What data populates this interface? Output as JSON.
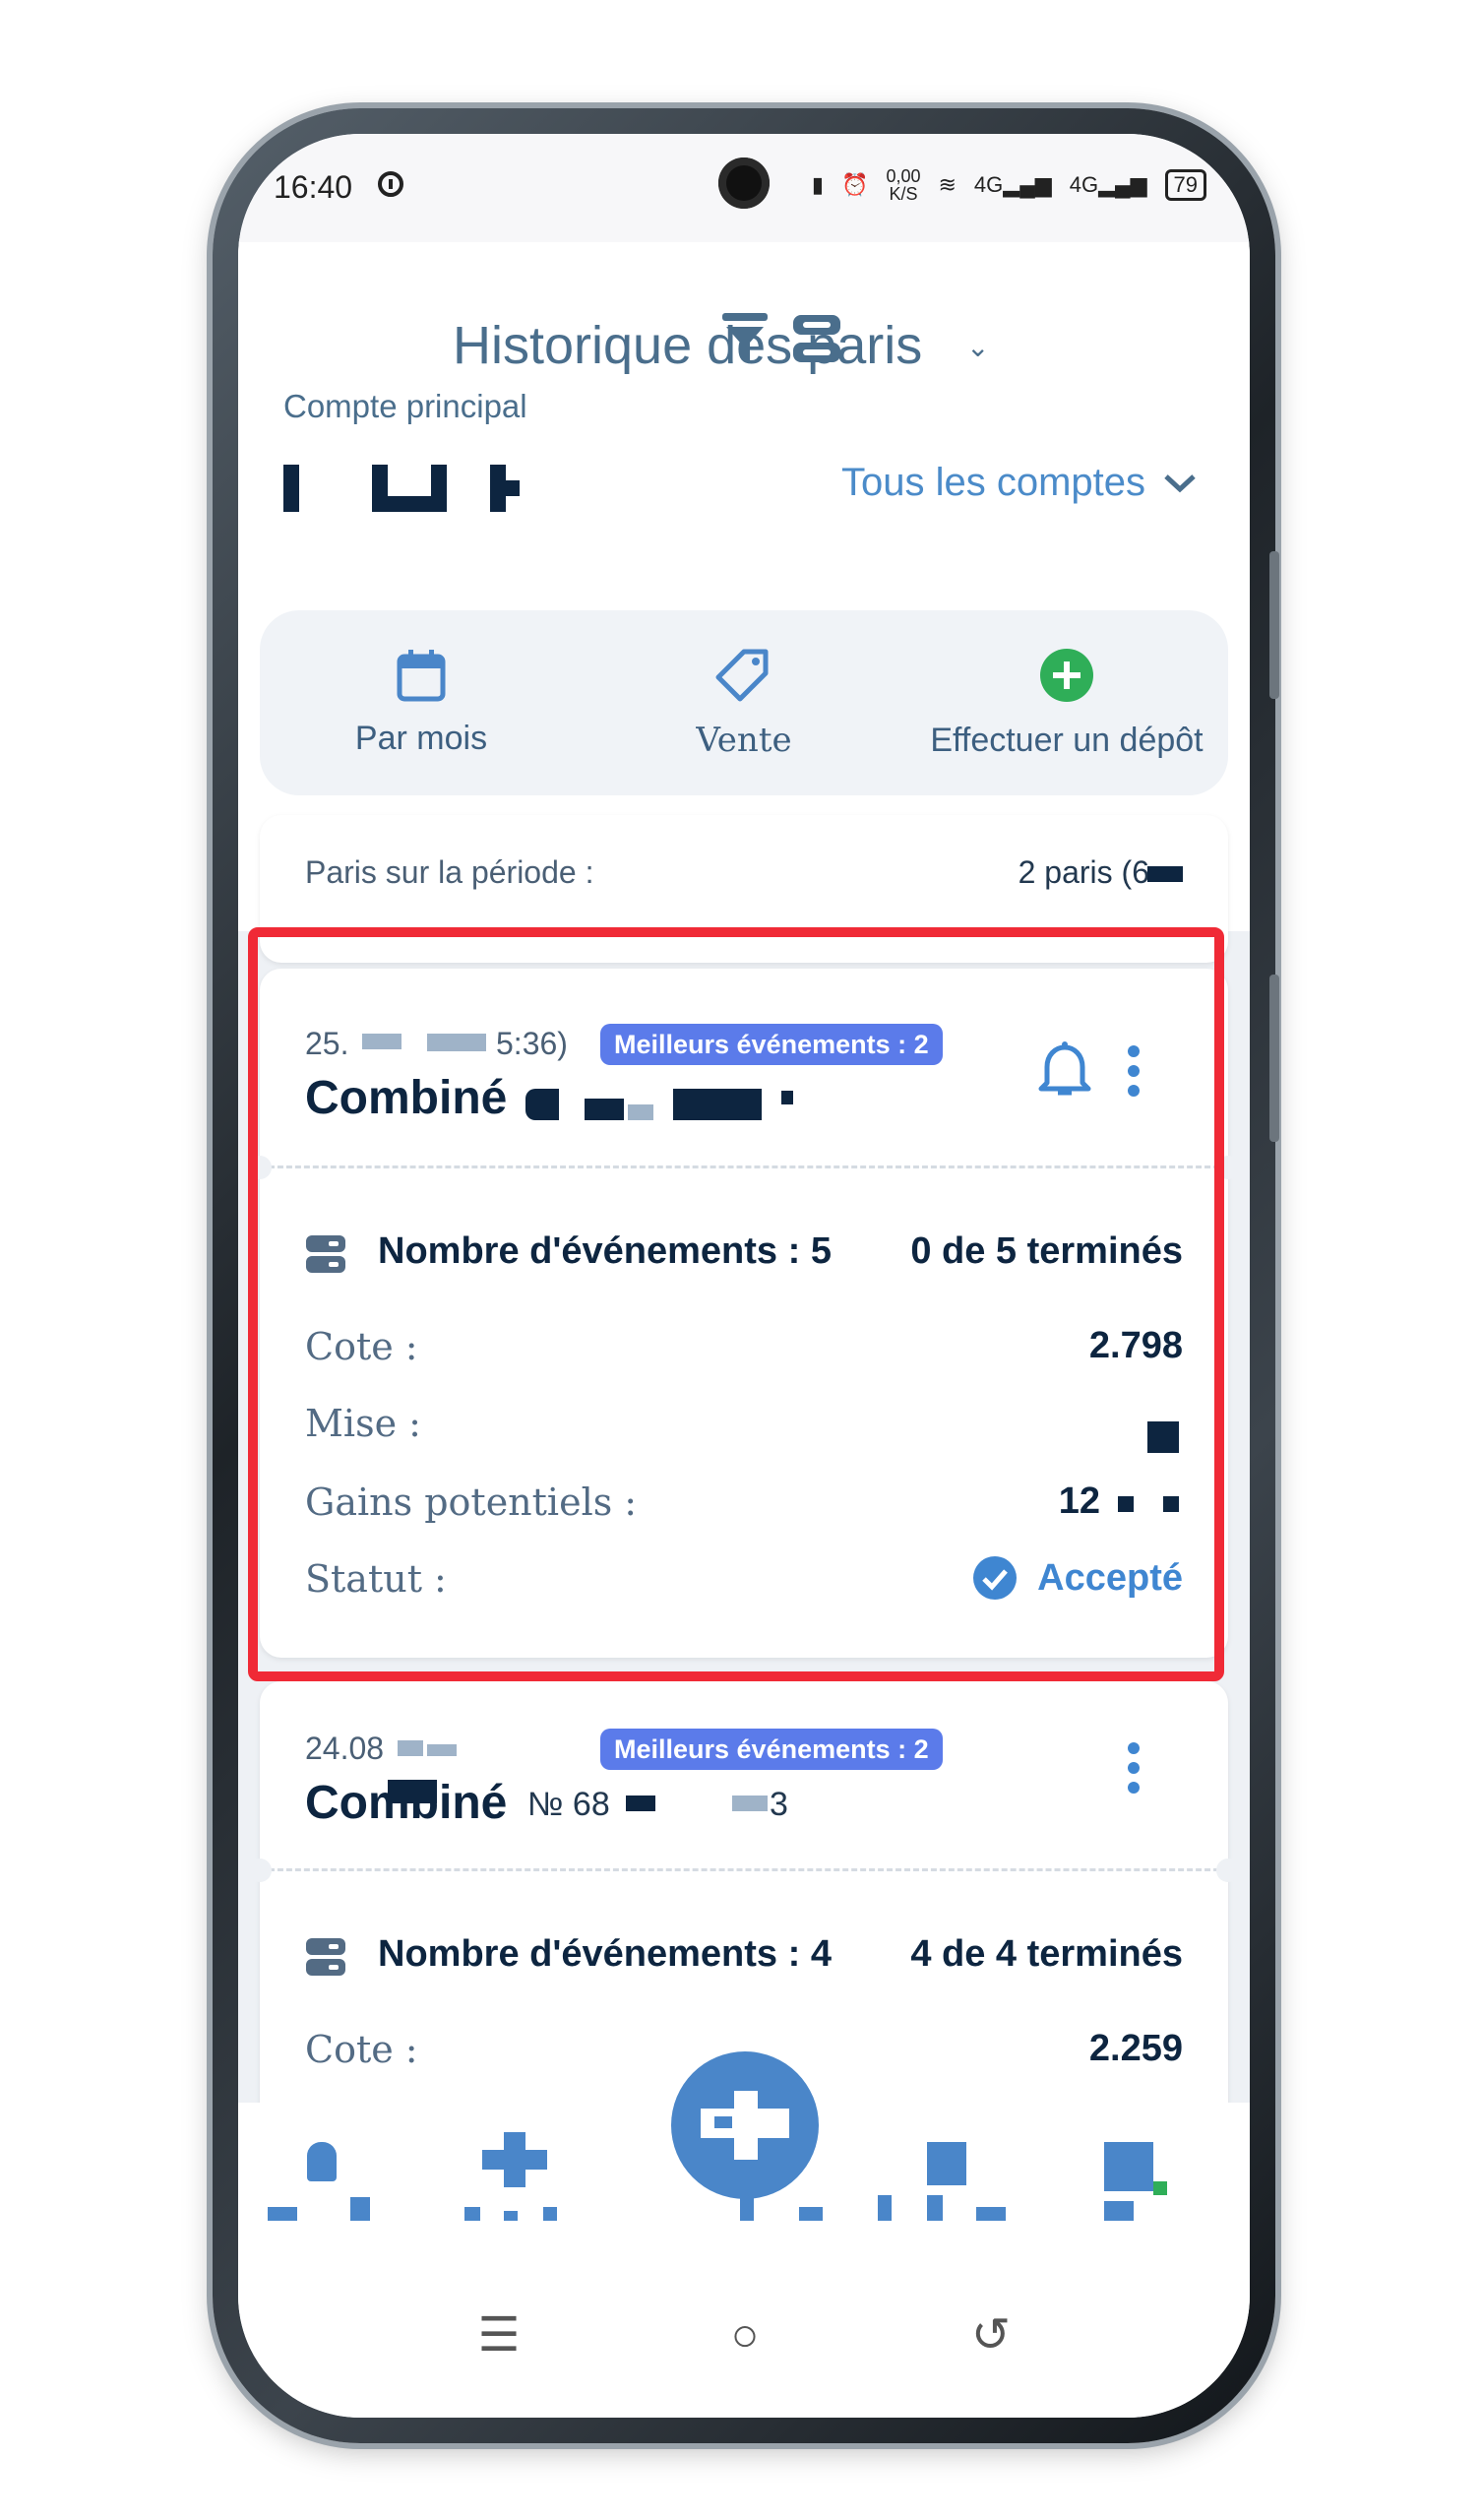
{
  "status_bar": {
    "time": "16:40",
    "network_speed": "0,00",
    "network_unit": "K/S",
    "signal1": "4G",
    "signal2": "4G",
    "battery": "79"
  },
  "header": {
    "title": "Historique des paris",
    "account_label": "Compte principal",
    "all_accounts": "Tous les comptes"
  },
  "actions": [
    {
      "label": "Par mois",
      "icon": "calendar-icon"
    },
    {
      "label": "Vente",
      "icon": "tag-icon"
    },
    {
      "label": "Effectuer un dépôt",
      "icon": "plus-circle-icon"
    }
  ],
  "period": {
    "label": "Paris sur la période :",
    "value": "2 paris (6"
  },
  "bets": [
    {
      "date": "25.",
      "time_fragment": "5:36)",
      "badge": "Meilleurs événements : 2",
      "title": "Combiné",
      "events_label": "Nombre d'événements : 5",
      "events_status": "0 de 5 terminés",
      "rows": [
        {
          "label": "Cote :",
          "value": "2.798"
        },
        {
          "label": "Mise :",
          "value": ""
        },
        {
          "label": "Gains potentiels :",
          "value": "12"
        },
        {
          "label": "Statut :",
          "value": "Accepté"
        }
      ]
    },
    {
      "date": "24.08",
      "badge": "Meilleurs événements : 2",
      "title": "Combiné",
      "number": "№ 68",
      "number_end": "3",
      "events_label": "Nombre d'événements : 4",
      "events_status": "4 de 4 terminés",
      "rows": [
        {
          "label": "Cote :",
          "value": "2.259"
        }
      ]
    }
  ],
  "colors": {
    "accent": "#4a86c9",
    "dark_text": "#0d2540",
    "badge": "#5b7bea",
    "highlight": "#f02a36",
    "success": "#3f86d1"
  }
}
